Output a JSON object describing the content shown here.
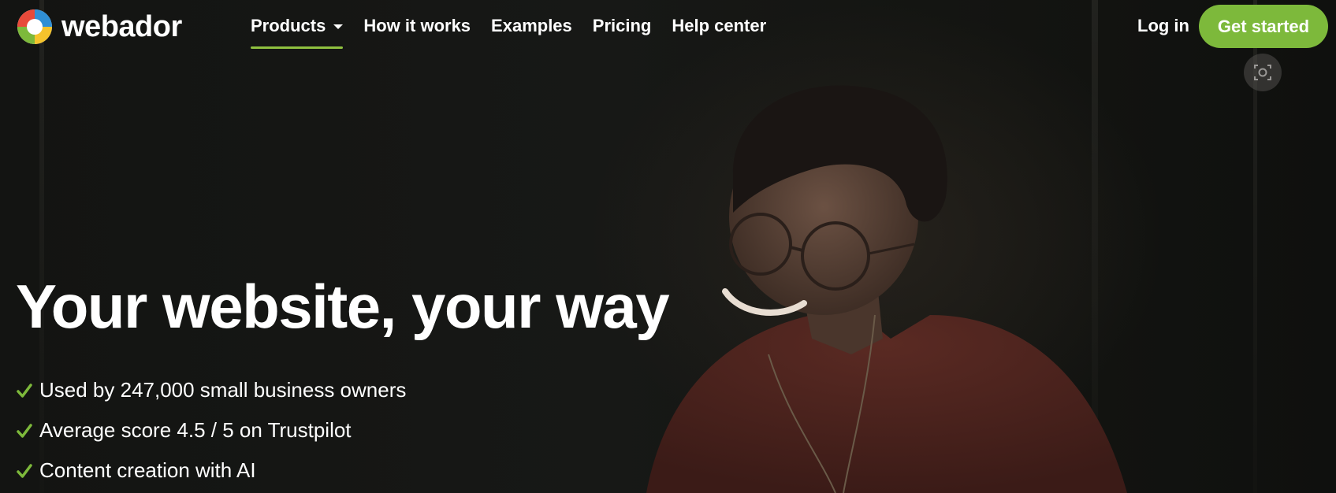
{
  "brand": {
    "name": "webador",
    "logo_icon": "webador-logo-icon"
  },
  "nav": {
    "items": [
      {
        "label": "Products",
        "active": true,
        "has_dropdown": true
      },
      {
        "label": "How it works"
      },
      {
        "label": "Examples"
      },
      {
        "label": "Pricing"
      },
      {
        "label": "Help center"
      }
    ],
    "login_label": "Log in",
    "cta_label": "Get started"
  },
  "hero": {
    "headline": "Your website, your way",
    "features": [
      "Used by 247,000 small business owners",
      "Average score 4.5 / 5 on Trustpilot",
      "Content creation with AI"
    ],
    "check_icon": "checkmark-icon",
    "photo_description_icon": "hero-photo"
  },
  "overlay": {
    "icon": "visual-search-icon"
  },
  "colors": {
    "accent_green": "#7db93b",
    "underline_green": "#8fc13f",
    "background": "#121311",
    "text": "#ffffff"
  }
}
